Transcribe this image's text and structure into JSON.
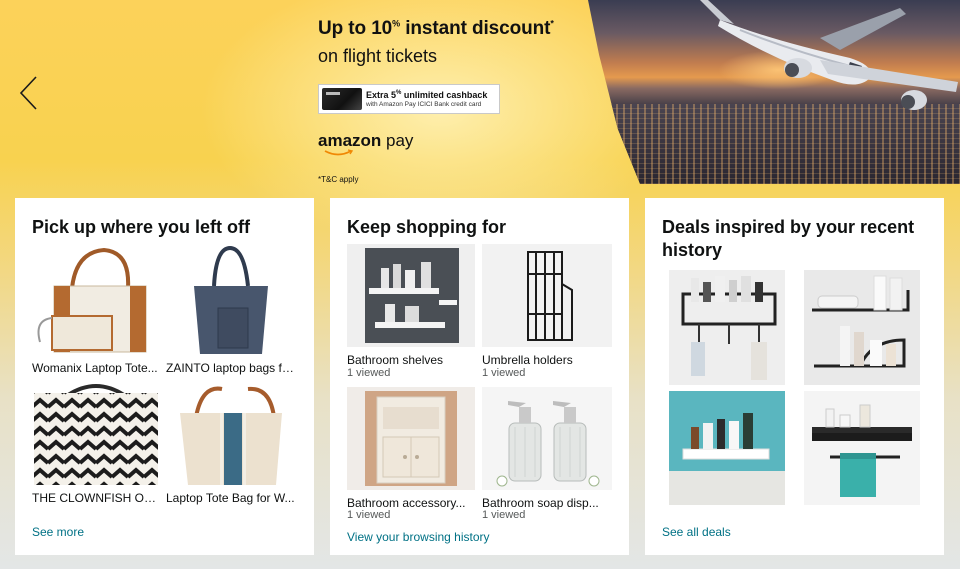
{
  "banner": {
    "title_prefix": "Up to 10",
    "title_sup": "%",
    "title_suffix": " instant discount",
    "title_star": "*",
    "subtitle": "on flight tickets",
    "cashback_prefix": "Extra 5",
    "cashback_sup": "%",
    "cashback_suffix": " unlimited cashback",
    "cashback_note": "with Amazon Pay ICICI Bank credit card",
    "brand_a": "amazon",
    "brand_b": " pay",
    "tnc": "*T&C apply",
    "prev_icon": "chevron-left-icon"
  },
  "cards": [
    {
      "title": "Pick up where you left off",
      "items": [
        {
          "label": "Womanix Laptop Tote..."
        },
        {
          "label": "ZAINTO laptop bags for..."
        },
        {
          "label": "THE CLOWNFISH Opul..."
        },
        {
          "label": "Laptop Tote Bag for W..."
        }
      ],
      "link": "See more"
    },
    {
      "title": "Keep shopping for",
      "items": [
        {
          "label": "Bathroom shelves",
          "sub": "1 viewed"
        },
        {
          "label": "Umbrella holders",
          "sub": "1 viewed"
        },
        {
          "label": "Bathroom accessory...",
          "sub": "1 viewed"
        },
        {
          "label": "Bathroom soap disp...",
          "sub": "1 viewed"
        }
      ],
      "link": "View your browsing history"
    },
    {
      "title": "Deals inspired by your recent history",
      "link": "See all deals"
    }
  ],
  "colors": {
    "banner_yellow": "#f8d24f",
    "link": "#007185",
    "text": "#0f1111",
    "muted": "#565959"
  }
}
